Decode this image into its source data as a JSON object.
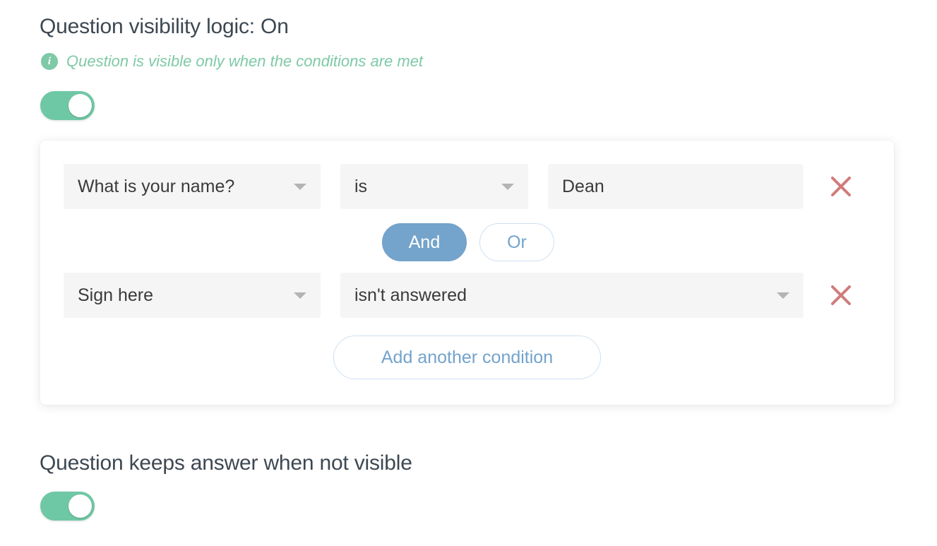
{
  "visibility_section": {
    "title": "Question visibility logic: On",
    "hint": {
      "icon": "info-icon",
      "text": "Question is visible only when the conditions are met"
    },
    "toggle": {
      "state": "on",
      "color": "#6fc8a5"
    }
  },
  "conditions_card": {
    "rows": [
      {
        "question": "What is your name?",
        "operator": "is",
        "value": "Dean",
        "value_type": "text",
        "remove_icon": "close-icon"
      },
      {
        "question": "Sign here",
        "operator": "isn't answered",
        "value": null,
        "value_type": "none",
        "remove_icon": "close-icon"
      }
    ],
    "logic_operators": [
      {
        "label": "And",
        "selected": true
      },
      {
        "label": "Or",
        "selected": false
      }
    ],
    "add_condition_label": "Add another condition",
    "colors": {
      "accent_blue": "#74a3cb",
      "remove_red": "#d07b7b",
      "field_bg": "#f5f5f5"
    }
  },
  "keep_answer_section": {
    "title": "Question keeps answer when not visible",
    "toggle": {
      "state": "on",
      "color": "#6fc8a5"
    }
  }
}
